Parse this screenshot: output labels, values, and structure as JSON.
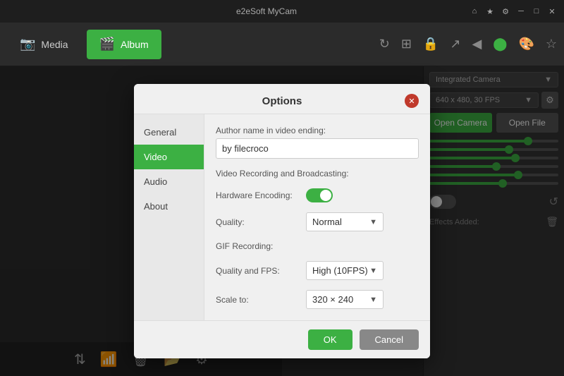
{
  "app": {
    "title": "e2eSoft MyCam"
  },
  "titlebar": {
    "controls": [
      "home",
      "star",
      "gear",
      "minimize",
      "maximize",
      "close"
    ]
  },
  "navbar": {
    "tabs": [
      {
        "id": "media",
        "label": "Media",
        "icon": "📷"
      },
      {
        "id": "album",
        "label": "Album",
        "icon": "🎬",
        "active": true
      }
    ],
    "icons": [
      "rotate",
      "grid",
      "lock",
      "share",
      "back",
      "camera",
      "palette",
      "star"
    ]
  },
  "right_panel": {
    "camera_label": "Integrated Camera",
    "fps_label": "640 x 480, 30 FPS",
    "open_camera_label": "Open Camera",
    "open_file_label": "Open File",
    "effects_label": "Effects Added:",
    "sliders": [
      {
        "fill": 80
      },
      {
        "fill": 65
      },
      {
        "fill": 70
      },
      {
        "fill": 55
      },
      {
        "fill": 72
      },
      {
        "fill": 60
      }
    ]
  },
  "bottom_toolbar": {
    "icons": [
      "swap",
      "wifi",
      "trash",
      "folder",
      "settings"
    ]
  },
  "dialog": {
    "title": "Options",
    "sidebar_items": [
      {
        "label": "General",
        "active": false
      },
      {
        "label": "Video",
        "active": true
      },
      {
        "label": "Audio",
        "active": false
      },
      {
        "label": "About",
        "active": false
      }
    ],
    "author_label": "Author name in video ending:",
    "author_value": "by filecroco",
    "video_recording_label": "Video Recording and Broadcasting:",
    "hardware_encoding_label": "Hardware Encoding:",
    "quality_label": "Quality:",
    "quality_value": "Normal",
    "gif_recording_label": "GIF Recording:",
    "gif_quality_label": "Quality and FPS:",
    "gif_quality_value": "High (10FPS)",
    "gif_scale_label": "Scale to:",
    "gif_scale_value": "320 × 240",
    "ok_label": "OK",
    "cancel_label": "Cancel"
  }
}
